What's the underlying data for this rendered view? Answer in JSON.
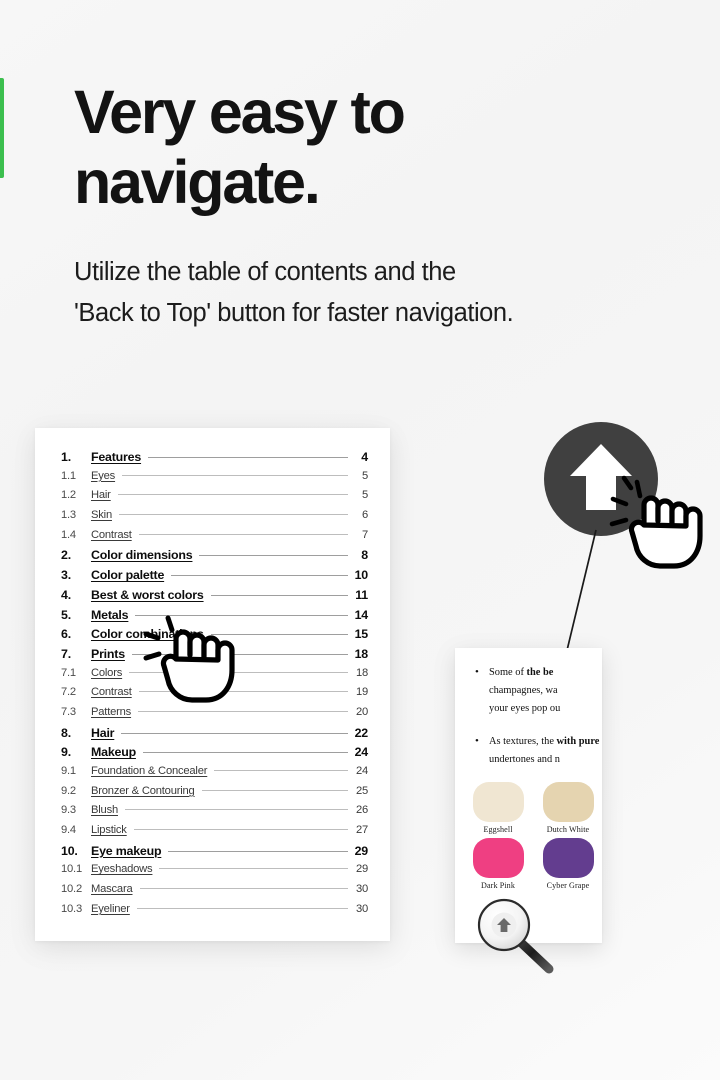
{
  "page": {
    "background_color": "#f5f5f5",
    "accent_color": "#3cbf4e"
  },
  "headline": {
    "line1": "Very easy to",
    "line2": "navigate."
  },
  "subhead": {
    "line1": "Utilize the table of contents and the",
    "line2": "'Back to Top' button for faster navigation."
  },
  "toc": {
    "rows": [
      {
        "num": "1.",
        "title": "Features",
        "page": "4",
        "level": 1
      },
      {
        "num": "1.1",
        "title": "Eyes",
        "page": "5",
        "level": 2
      },
      {
        "num": "1.2",
        "title": "Hair",
        "page": "5",
        "level": 2
      },
      {
        "num": "1.3",
        "title": "Skin",
        "page": "6",
        "level": 2
      },
      {
        "num": "1.4",
        "title": "Contrast",
        "page": "7",
        "level": 2
      },
      {
        "num": "2.",
        "title": "Color dimensions",
        "page": "8",
        "level": 1
      },
      {
        "num": "3.",
        "title": "Color palette",
        "page": "10",
        "level": 1
      },
      {
        "num": "4.",
        "title": "Best & worst colors",
        "page": "11",
        "level": 1
      },
      {
        "num": "5.",
        "title": "Metals",
        "page": "14",
        "level": 1
      },
      {
        "num": "6.",
        "title": "Color combinations",
        "page": "15",
        "level": 1
      },
      {
        "num": "7.",
        "title": "Prints",
        "page": "18",
        "level": 1
      },
      {
        "num": "7.1",
        "title": "Colors",
        "page": "18",
        "level": 2
      },
      {
        "num": "7.2",
        "title": "Contrast",
        "page": "19",
        "level": 2
      },
      {
        "num": "7.3",
        "title": "Patterns",
        "page": "20",
        "level": 2
      },
      {
        "num": "8.",
        "title": "Hair",
        "page": "22",
        "level": 1
      },
      {
        "num": "9.",
        "title": "Makeup",
        "page": "24",
        "level": 1
      },
      {
        "num": "9.1",
        "title": "Foundation & Concealer",
        "page": "24",
        "level": 2
      },
      {
        "num": "9.2",
        "title": "Bronzer & Contouring",
        "page": "25",
        "level": 2
      },
      {
        "num": "9.3",
        "title": "Blush",
        "page": "26",
        "level": 2
      },
      {
        "num": "9.4",
        "title": "Lipstick",
        "page": "27",
        "level": 2
      },
      {
        "num": "10.",
        "title": "Eye makeup",
        "page": "29",
        "level": 1
      },
      {
        "num": "10.1",
        "title": "Eyeshadows",
        "page": "29",
        "level": 2
      },
      {
        "num": "10.2",
        "title": "Mascara",
        "page": "30",
        "level": 2
      },
      {
        "num": "10.3",
        "title": "Eyeliner",
        "page": "30",
        "level": 2
      }
    ]
  },
  "doc_panel": {
    "bullets": [
      {
        "prefix": "Some of ",
        "bold": "the be",
        "rest": "",
        "lines": [
          "champagnes, wa",
          "your eyes pop ou"
        ]
      },
      {
        "prefix": "As textures, the ",
        "bold": "with pure pigm",
        "rest": "",
        "lines": [
          "undertones and n"
        ]
      }
    ],
    "swatches": [
      {
        "name": "Eggshell",
        "color": "#f0e6d2"
      },
      {
        "name": "Dutch White",
        "color": "#e5d4b0"
      },
      {
        "name": "",
        "color": "#e8dcc2"
      },
      {
        "name": "Dark Pink",
        "color": "#ef3f82"
      },
      {
        "name": "Cyber Grape",
        "color": "#633d8f"
      },
      {
        "name": "",
        "color": "#1091a5"
      }
    ]
  },
  "back_to_top": {
    "label": "Back to Top",
    "icon": "arrow-up-icon",
    "circle_color": "#404040",
    "arrow_color": "#ffffff"
  },
  "loupe": {
    "icon": "magnifier-icon"
  },
  "cursors": {
    "toc_cursor": "pointing-hand-click-cursor",
    "button_cursor": "pointing-hand-click-cursor"
  }
}
